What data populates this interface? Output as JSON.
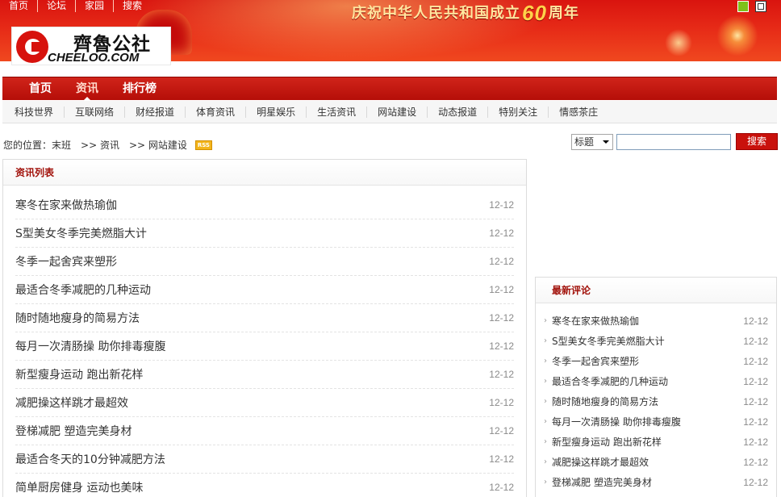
{
  "top_links": [
    "首页",
    "论坛",
    "家园",
    "搜索"
  ],
  "slogan": {
    "prefix": "庆祝中华人民共和国成立",
    "number": "60",
    "suffix": "周年"
  },
  "logo": {
    "cn": "齊魯公社",
    "en": "CHEELOO.COM"
  },
  "colors": {
    "brand_red": "#c9110c",
    "skin_green": "#7ec11a"
  },
  "main_nav": [
    {
      "label": "首页",
      "active": false
    },
    {
      "label": "资讯",
      "active": true
    },
    {
      "label": "排行榜",
      "active": false
    }
  ],
  "sub_nav": [
    "科技世界",
    "互联网络",
    "财经报道",
    "体育资讯",
    "明星娱乐",
    "生活资讯",
    "网站建设",
    "动态报道",
    "特别关注",
    "情感茶庄"
  ],
  "breadcrumb": {
    "prefix": "您的位置：",
    "items": [
      "末班",
      ">> 资讯",
      ">> 网站建设"
    ],
    "rss": "RSS"
  },
  "search": {
    "select_value": "标题",
    "input_value": "",
    "button_label": "搜索"
  },
  "left_panel": {
    "title": "资讯列表",
    "items": [
      {
        "title": "寒冬在家来做热瑜伽",
        "date": "12-12"
      },
      {
        "title": "S型美女冬季完美燃脂大计",
        "date": "12-12"
      },
      {
        "title": "冬季一起舍宾来塑形",
        "date": "12-12"
      },
      {
        "title": "最适合冬季减肥的几种运动",
        "date": "12-12"
      },
      {
        "title": "随时随地瘦身的简易方法",
        "date": "12-12"
      },
      {
        "title": "每月一次清肠操 助你排毒瘦腹",
        "date": "12-12"
      },
      {
        "title": "新型瘦身运动 跑出新花样",
        "date": "12-12"
      },
      {
        "title": "减肥操这样跳才最超效",
        "date": "12-12"
      },
      {
        "title": "登梯减肥 塑造完美身材",
        "date": "12-12"
      },
      {
        "title": "最适合冬天的10分钟减肥方法",
        "date": "12-12"
      },
      {
        "title": "简单厨房健身 运动也美味",
        "date": "12-12"
      }
    ]
  },
  "right_panel": {
    "title": "最新评论",
    "items": [
      {
        "title": "寒冬在家来做热瑜伽",
        "date": "12-12"
      },
      {
        "title": "S型美女冬季完美燃脂大计",
        "date": "12-12"
      },
      {
        "title": "冬季一起舍宾来塑形",
        "date": "12-12"
      },
      {
        "title": "最适合冬季减肥的几种运动",
        "date": "12-12"
      },
      {
        "title": "随时随地瘦身的简易方法",
        "date": "12-12"
      },
      {
        "title": "每月一次清肠操 助你排毒瘦腹",
        "date": "12-12"
      },
      {
        "title": "新型瘦身运动 跑出新花样",
        "date": "12-12"
      },
      {
        "title": "减肥操这样跳才最超效",
        "date": "12-12"
      },
      {
        "title": "登梯减肥 塑造完美身材",
        "date": "12-12"
      }
    ]
  }
}
